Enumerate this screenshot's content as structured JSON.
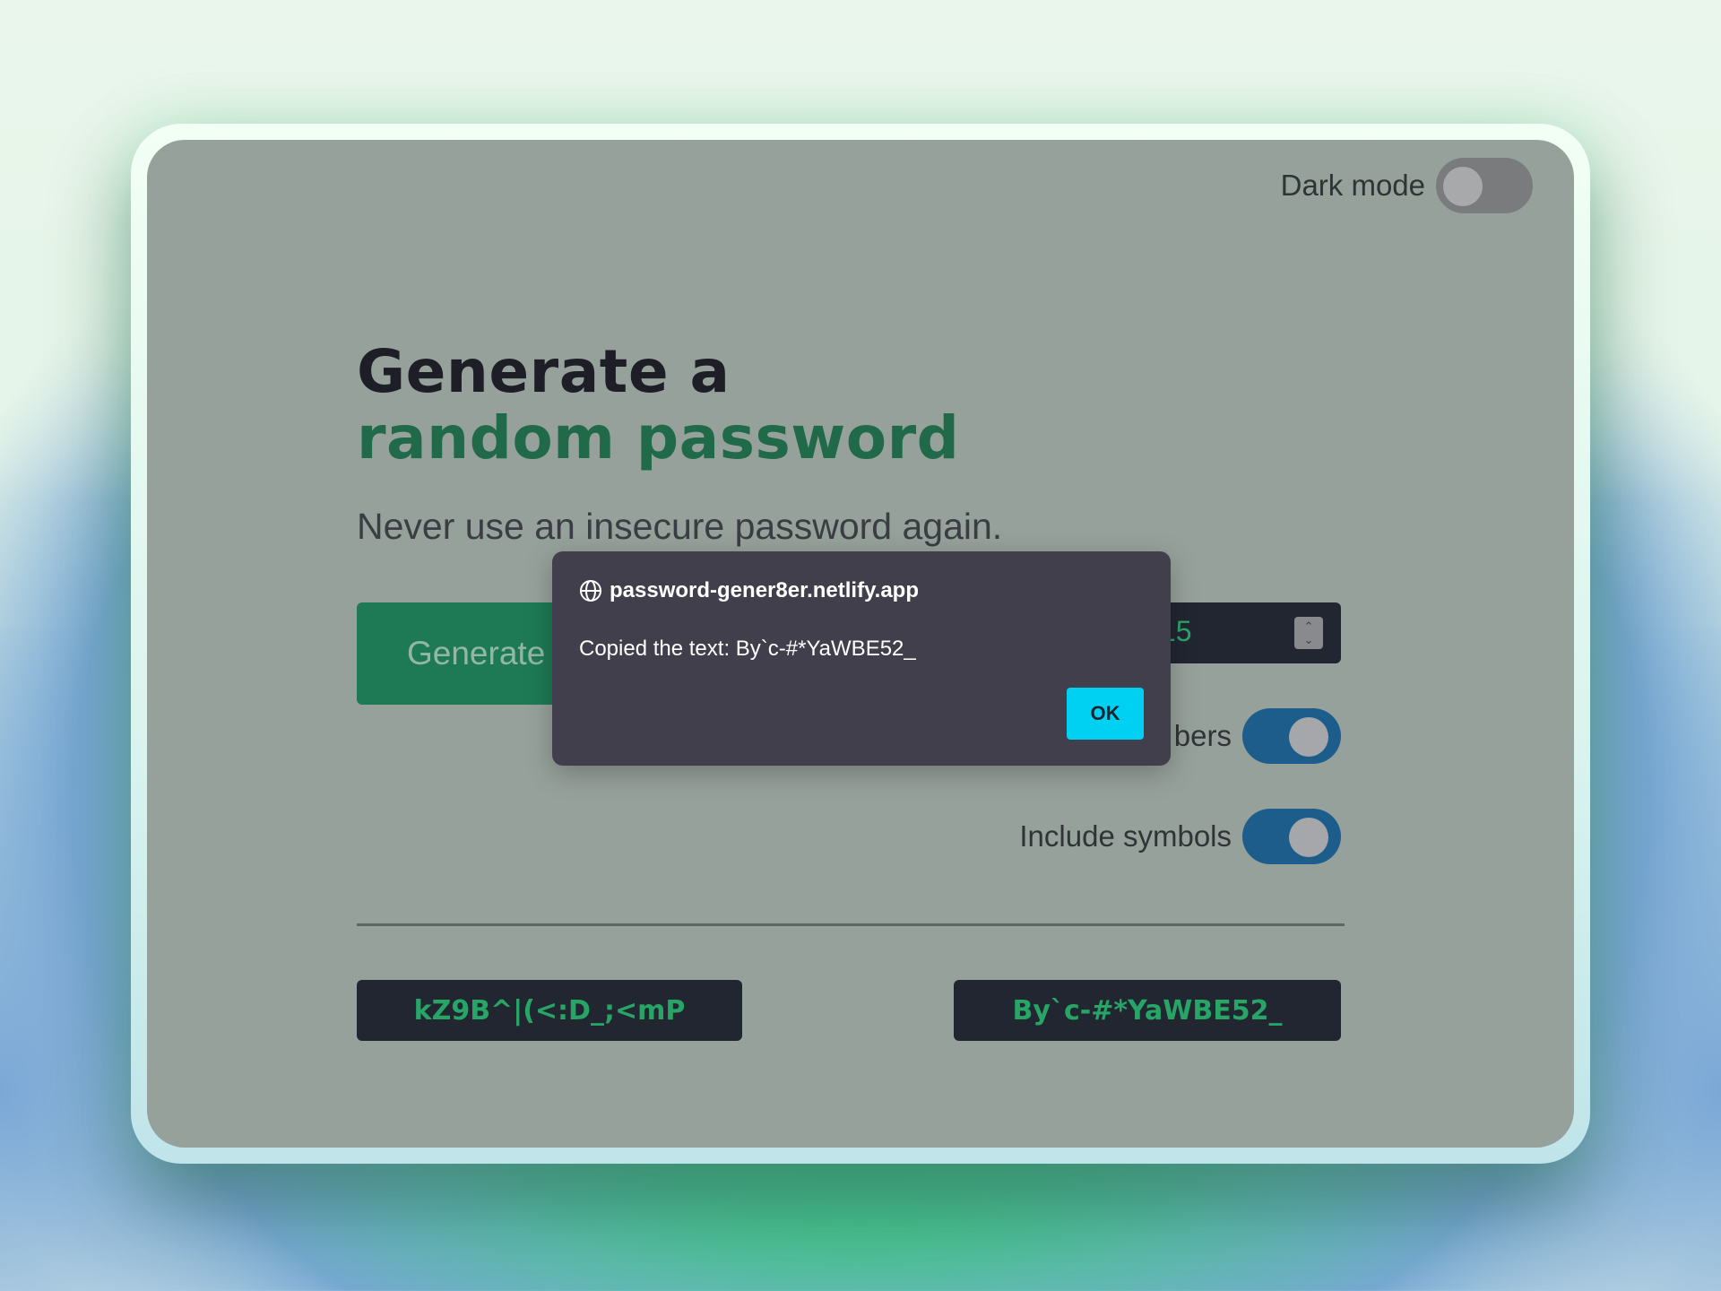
{
  "colors": {
    "page_bg": "#97a19b",
    "accent_green": "#206a49",
    "button_green": "#1e7a55",
    "password_text": "#27a567",
    "toggle_on": "#1c5d8b",
    "dialog_bg": "#403f4b",
    "ok_button": "#00d0f2"
  },
  "header": {
    "dark_mode_label": "Dark mode",
    "dark_mode_on": false
  },
  "hero": {
    "title_line1": "Generate a",
    "title_line2": "random password",
    "subtitle": "Never use an insecure password again."
  },
  "controls": {
    "generate_label": "Generate",
    "length_value": "15",
    "numbers_label": "bers",
    "numbers_on": true,
    "symbols_label": "Include symbols",
    "symbols_on": true
  },
  "passwords": [
    "kZ9B^|(<:D_;<mP",
    "By`c-#*YaWBE52_"
  ],
  "dialog": {
    "host": "password-gener8er.netlify.app",
    "message": "Copied the text: By`c-#*YaWBE52_",
    "ok_label": "OK"
  }
}
